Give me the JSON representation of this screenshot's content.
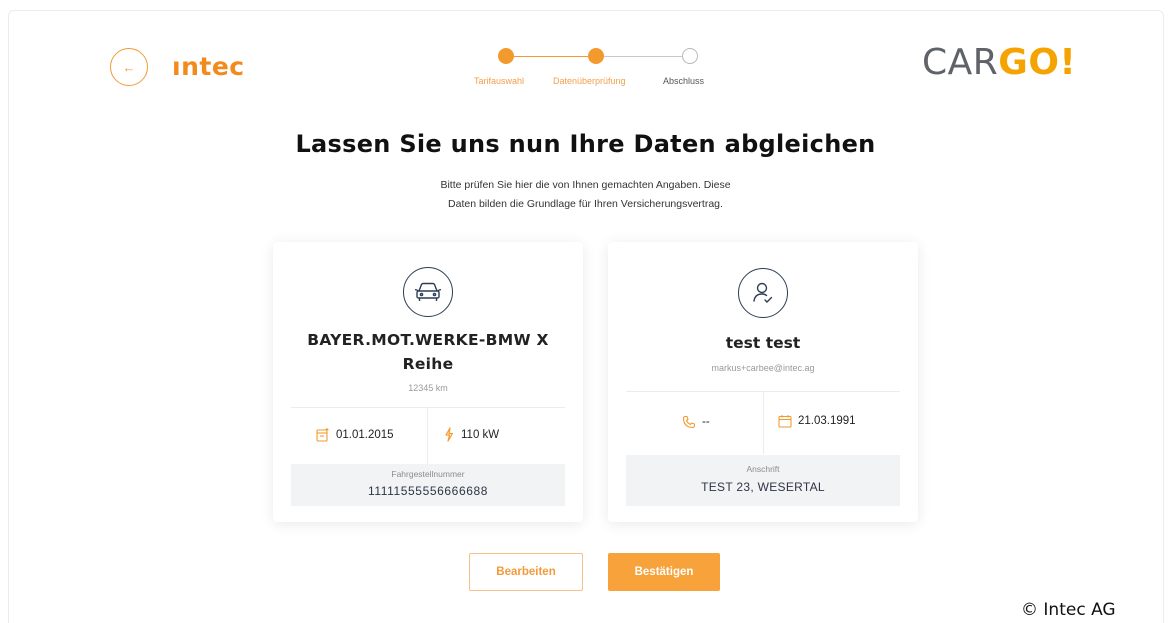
{
  "header": {
    "back_icon": "arrow-left-icon",
    "brand_left": "ıntec",
    "brand_right_part1": "CAR",
    "brand_right_part2": "GO!"
  },
  "stepper": {
    "steps": [
      {
        "label": "Tarifauswahl",
        "state": "done"
      },
      {
        "label": "Datenüberprüfung",
        "state": "done"
      },
      {
        "label": "Abschluss",
        "state": "open"
      }
    ],
    "accent": "#f39a2e"
  },
  "main": {
    "title": "Lassen Sie uns nun Ihre Daten abgleichen",
    "subtitle_line1": "Bitte prüfen Sie hier die von Ihnen gemachten Angaben. Diese",
    "subtitle_line2": "Daten bilden die Grundlage für Ihren Versicherungsvertrag."
  },
  "vehicle_card": {
    "icon": "car-icon",
    "name_line1": "BAYER.MOT.WERKE-BMW X",
    "name_line2": "Reihe",
    "mileage": "12345 km",
    "first_registration": "01.01.2015",
    "first_registration_icon": "calendar-plus-icon",
    "power": "110 kW",
    "power_icon": "bolt-icon",
    "vin_label": "Fahrgestellnummer",
    "vin_value": "11111555556666688"
  },
  "person_card": {
    "icon": "user-check-icon",
    "name": "test test",
    "email": "markus+carbee@intec.ag",
    "phone": "--",
    "phone_icon": "phone-icon",
    "birth_date": "21.03.1991",
    "birth_date_icon": "calendar-icon",
    "address_label": "Anschrift",
    "address_value": "TEST 23, WESERTAL"
  },
  "actions": {
    "edit_label": "Bearbeiten",
    "confirm_label": "Bestätigen"
  },
  "footer": {
    "copyright": "© Intec AG"
  },
  "colors": {
    "accent": "#f39a2e",
    "brand_yellow": "#f5a300",
    "navy": "#2c3e55"
  }
}
